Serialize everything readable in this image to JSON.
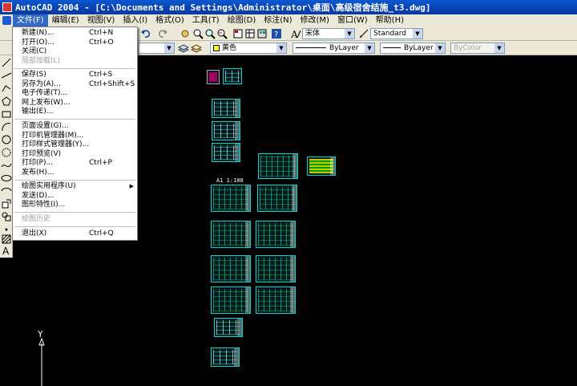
{
  "window": {
    "title": "AutoCAD 2004 - [C:\\Documents and Settings\\Administrator\\桌面\\高级宿舍结施_t3.dwg]"
  },
  "menubar": {
    "items": [
      "文件(F)",
      "编辑(E)",
      "视图(V)",
      "插入(I)",
      "格式(O)",
      "工具(T)",
      "绘图(D)",
      "标注(N)",
      "修改(M)",
      "窗口(W)",
      "帮助(H)"
    ]
  },
  "properties_toolbar": {
    "text_style": "宋体",
    "dim_style": "Standard",
    "color": "黄色",
    "linetype": "ByLayer",
    "lineweight": "ByLayer",
    "plotstyle": "ByColor"
  },
  "file_menu": {
    "items": [
      {
        "label": "新建(N)...",
        "shortcut": "Ctrl+N",
        "enabled": true
      },
      {
        "label": "打开(O)...",
        "shortcut": "Ctrl+O",
        "enabled": true
      },
      {
        "label": "关闭(C)",
        "shortcut": "",
        "enabled": true
      },
      {
        "label": "局部加载(L)",
        "shortcut": "",
        "enabled": false
      },
      {
        "label": "保存(S)",
        "shortcut": "Ctrl+S",
        "enabled": true
      },
      {
        "label": "另存为(A)...",
        "shortcut": "Ctrl+Shift+S",
        "enabled": true
      },
      {
        "label": "电子传递(T)...",
        "shortcut": "",
        "enabled": true
      },
      {
        "label": "网上发布(W)...",
        "shortcut": "",
        "enabled": true
      },
      {
        "label": "输出(E)...",
        "shortcut": "",
        "enabled": true
      },
      {
        "label": "页面设置(G)...",
        "shortcut": "",
        "enabled": true
      },
      {
        "label": "打印机管理器(M)...",
        "shortcut": "",
        "enabled": true
      },
      {
        "label": "打印样式管理器(Y)...",
        "shortcut": "",
        "enabled": true
      },
      {
        "label": "打印预览(V)",
        "shortcut": "",
        "enabled": true
      },
      {
        "label": "打印(P)...",
        "shortcut": "Ctrl+P",
        "enabled": true
      },
      {
        "label": "发布(H)...",
        "shortcut": "",
        "enabled": true
      },
      {
        "label": "绘图实用程序(U)",
        "shortcut": "",
        "enabled": true,
        "submenu": true
      },
      {
        "label": "发送(D)...",
        "shortcut": "",
        "enabled": true
      },
      {
        "label": "图形特性(I)...",
        "shortcut": "",
        "enabled": true
      },
      {
        "label": "绘图历史",
        "shortcut": "",
        "enabled": false
      },
      {
        "label": "退出(X)",
        "shortcut": "Ctrl+Q",
        "enabled": true
      }
    ]
  },
  "canvas": {
    "drawing_label": "A1 1:100",
    "ucs_y_label": "Y"
  },
  "colors": {
    "canvas_bg": "#000000",
    "sheet_border": "#00d8d8",
    "menu_highlight": "#316ac5",
    "title_bar": "#0842b0"
  }
}
